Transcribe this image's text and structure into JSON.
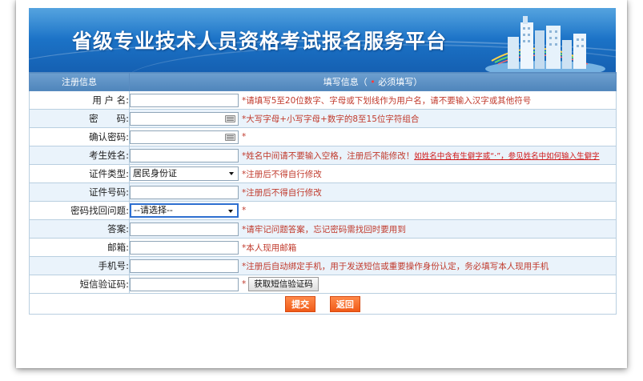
{
  "banner": {
    "title": "省级专业技术人员资格考试报名服务平台"
  },
  "header": {
    "left": "注册信息",
    "right_prefix": "填写信息（",
    "right_star": "•",
    "right_suffix": "必须填写）"
  },
  "rows": [
    {
      "label": "用 户 名:",
      "note": "*请填写5至20位数字、字母或下划线作为用户名，请不要输入汉字或其他符号"
    },
    {
      "label": "密　　码:",
      "note": "*大写字母+小写字母+数字的8至15位字符组合"
    },
    {
      "label": "确认密码:",
      "note": "*"
    },
    {
      "label": "考生姓名:",
      "note": "*姓名中间请不要输入空格，注册后不能修改！",
      "link": "如姓名中含有生僻字或“·”，参见姓名中如何输入生僻字"
    },
    {
      "label": "证件类型:",
      "select": "居民身份证",
      "note": "*注册后不得自行修改"
    },
    {
      "label": "证件号码:",
      "note": "*注册后不得自行修改"
    },
    {
      "label": "密码找回问题:",
      "select": "--请选择--",
      "note": "*"
    },
    {
      "label": "答案:",
      "note": "*请牢记问题答案，忘记密码需找回时要用到"
    },
    {
      "label": "邮箱:",
      "note": "*本人现用邮箱"
    },
    {
      "label": "手机号:",
      "note": "*注册后自动绑定手机，用于发送短信或重要操作身份认定，务必填写本人现用手机"
    },
    {
      "label": "短信验证码:",
      "note": "*",
      "button": "获取短信验证码"
    }
  ],
  "actions": {
    "submit": "提交",
    "back": "返回"
  }
}
